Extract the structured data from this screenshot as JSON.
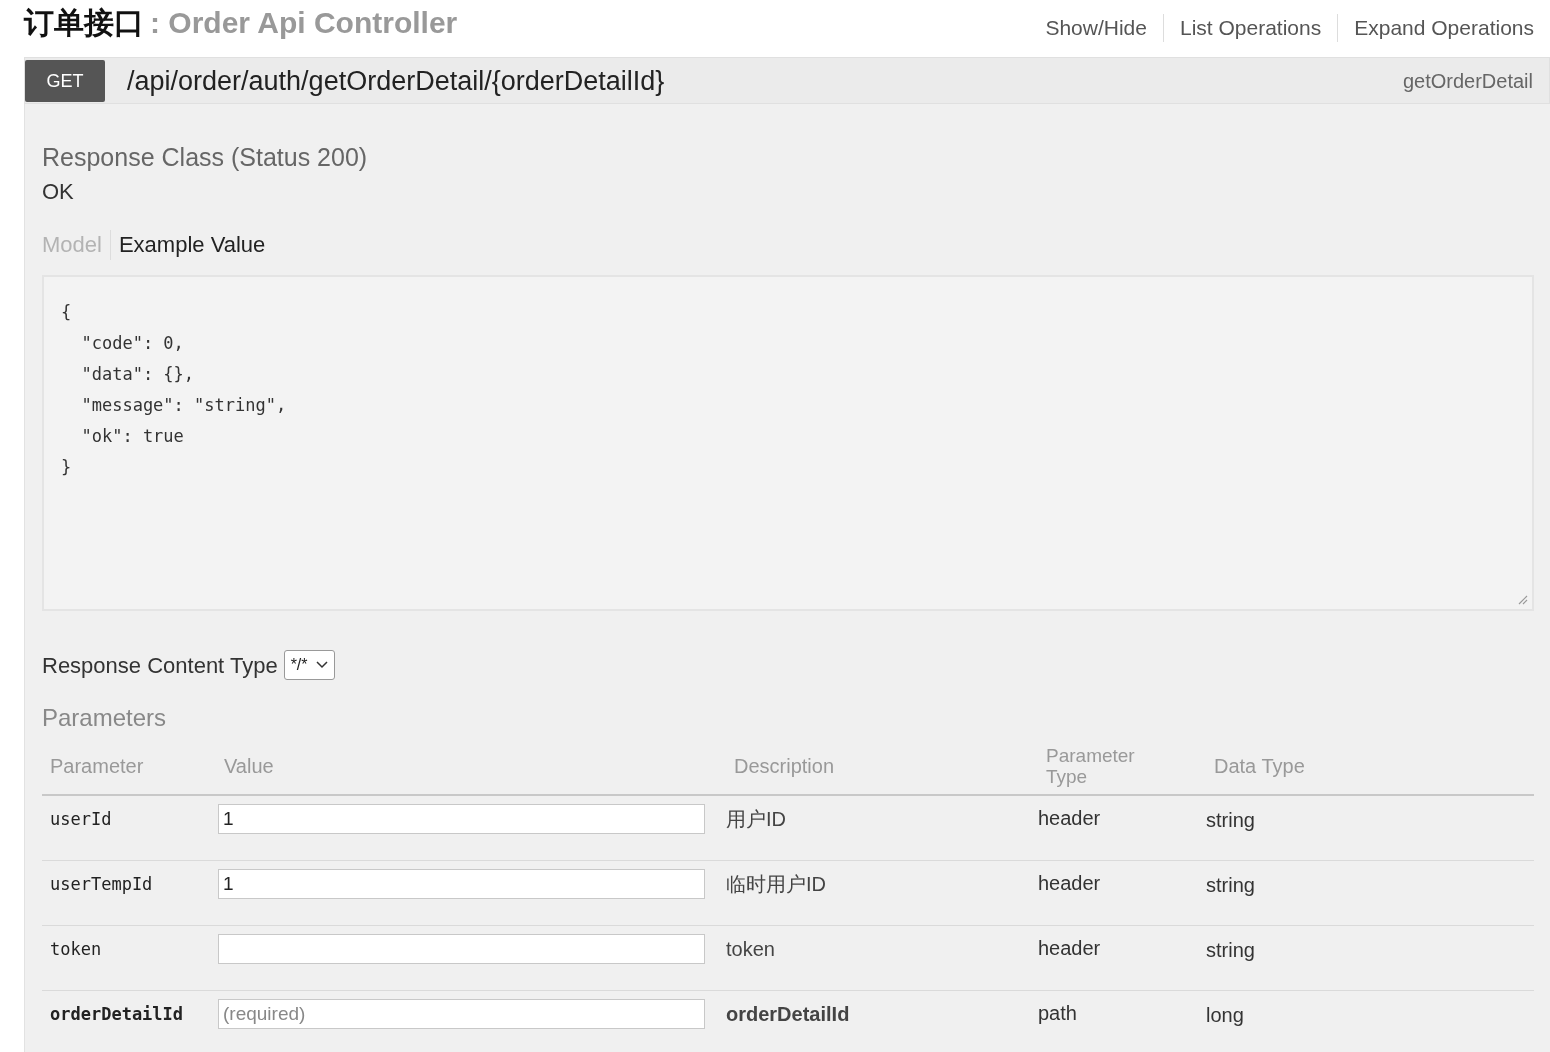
{
  "header": {
    "title": "订单接口",
    "subtitle": ": Order Api Controller",
    "links": [
      "Show/Hide",
      "List Operations",
      "Expand Operations"
    ]
  },
  "operation": {
    "method": "GET",
    "path": "/api/order/auth/getOrderDetail/{orderDetailId}",
    "nickname": "getOrderDetail"
  },
  "response_class": {
    "heading": "Response Class (Status 200)",
    "text": "OK"
  },
  "model_tabs": [
    {
      "label": "Model",
      "selected": false
    },
    {
      "label": "Example Value",
      "selected": true
    }
  ],
  "example_value": "{\n  \"code\": 0,\n  \"data\": {},\n  \"message\": \"string\",\n  \"ok\": true\n}",
  "response_content_type": {
    "label": "Response Content Type",
    "value": "*/*"
  },
  "parameters": {
    "heading": "Parameters",
    "columns": [
      "Parameter",
      "Value",
      "Description",
      "Parameter Type",
      "Data Type"
    ],
    "rows": [
      {
        "name": "userId",
        "value": "1",
        "description": "用户ID",
        "parameter_type": "header",
        "data_type": "string",
        "required": false
      },
      {
        "name": "userTempId",
        "value": "1",
        "description": "临时用户ID",
        "parameter_type": "header",
        "data_type": "string",
        "required": false
      },
      {
        "name": "token",
        "description": "token",
        "parameter_type": "header",
        "data_type": "string",
        "required": false
      },
      {
        "name": "orderDetailId",
        "placeholder": "(required)",
        "description": "orderDetailId",
        "parameter_type": "path",
        "data_type": "long",
        "required": true
      }
    ]
  }
}
